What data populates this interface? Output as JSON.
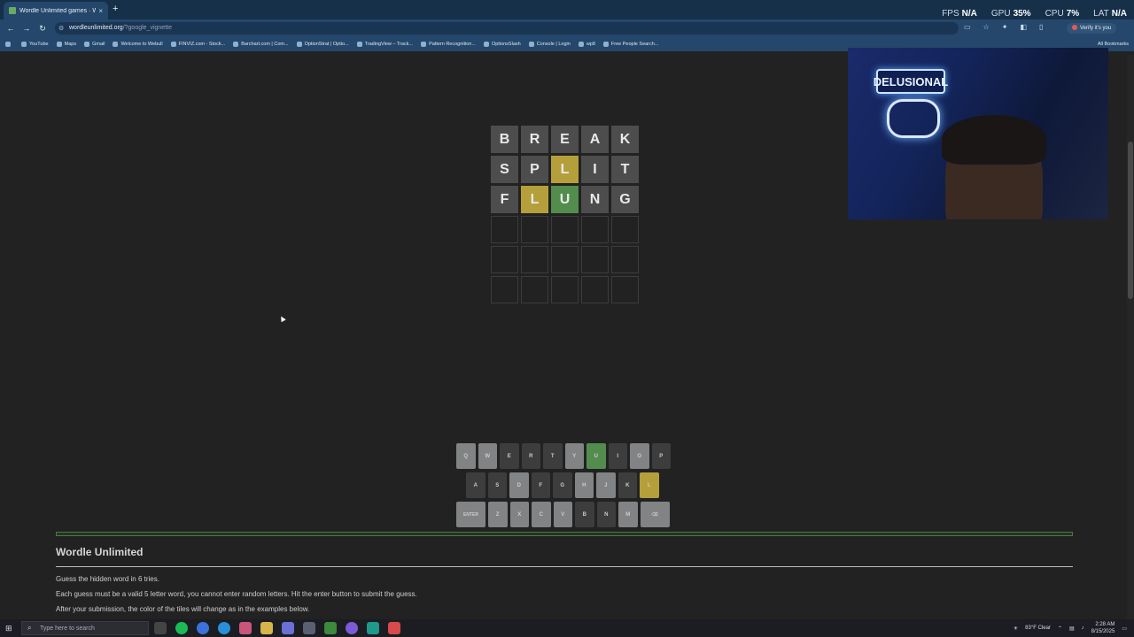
{
  "browser": {
    "tab_title": "Wordle Unlimited games · Wo",
    "tab_close": "×",
    "new_tab": "+",
    "url_host": "wordleunlimited.org",
    "url_path": "/?google_vignette",
    "verify_label": "Verify it's you",
    "bookmarks": [
      "YouTube",
      "Maps",
      "Gmail",
      "Welcome to Webull",
      "FINVIZ.com - Stock...",
      "Barchart.com | Com...",
      "OptionStrat | Optio...",
      "TradingView – Track...",
      "Pattern Recognition...",
      "OptionsSlash",
      "Console | Login",
      "wp8",
      "Free People Search..."
    ],
    "all_bookmarks": "All Bookmarks"
  },
  "overlay": {
    "fps_label": "FPS",
    "fps_value": "N/A",
    "gpu_label": "GPU",
    "gpu_value": "35%",
    "cpu_label": "CPU",
    "cpu_value": "7%",
    "lat_label": "LAT",
    "lat_value": "N/A"
  },
  "webcam": {
    "sign_text": "DELUSIONAL"
  },
  "board": {
    "rows": [
      [
        {
          "l": "B",
          "s": "absent"
        },
        {
          "l": "R",
          "s": "absent"
        },
        {
          "l": "E",
          "s": "absent"
        },
        {
          "l": "A",
          "s": "absent"
        },
        {
          "l": "K",
          "s": "absent"
        }
      ],
      [
        {
          "l": "S",
          "s": "absent"
        },
        {
          "l": "P",
          "s": "absent"
        },
        {
          "l": "L",
          "s": "present"
        },
        {
          "l": "I",
          "s": "absent"
        },
        {
          "l": "T",
          "s": "absent"
        }
      ],
      [
        {
          "l": "F",
          "s": "absent"
        },
        {
          "l": "L",
          "s": "present"
        },
        {
          "l": "U",
          "s": "correct"
        },
        {
          "l": "N",
          "s": "absent"
        },
        {
          "l": "G",
          "s": "absent"
        }
      ]
    ],
    "total_rows": 6
  },
  "keyboard": {
    "rows": [
      [
        {
          "k": "Q",
          "s": "used"
        },
        {
          "k": "W",
          "s": "used"
        },
        {
          "k": "E",
          "s": ""
        },
        {
          "k": "R",
          "s": ""
        },
        {
          "k": "T",
          "s": ""
        },
        {
          "k": "Y",
          "s": "used"
        },
        {
          "k": "U",
          "s": "correct"
        },
        {
          "k": "I",
          "s": ""
        },
        {
          "k": "O",
          "s": "used"
        },
        {
          "k": "P",
          "s": ""
        }
      ],
      [
        {
          "k": "A",
          "s": ""
        },
        {
          "k": "S",
          "s": ""
        },
        {
          "k": "D",
          "s": "used"
        },
        {
          "k": "F",
          "s": ""
        },
        {
          "k": "G",
          "s": ""
        },
        {
          "k": "H",
          "s": "used"
        },
        {
          "k": "J",
          "s": "used"
        },
        {
          "k": "K",
          "s": ""
        },
        {
          "k": "L",
          "s": "present"
        }
      ],
      [
        {
          "k": "ENTER",
          "s": "used",
          "wide": true
        },
        {
          "k": "Z",
          "s": "used"
        },
        {
          "k": "X",
          "s": "used"
        },
        {
          "k": "C",
          "s": "used"
        },
        {
          "k": "V",
          "s": "used"
        },
        {
          "k": "B",
          "s": ""
        },
        {
          "k": "N",
          "s": ""
        },
        {
          "k": "M",
          "s": "used"
        },
        {
          "k": "⌫",
          "s": "used",
          "wide": true
        }
      ]
    ]
  },
  "info": {
    "title": "Wordle Unlimited",
    "line1": "Guess the hidden word in 6 tries.",
    "line2": "Each guess must be a valid 5 letter word, you cannot enter random letters. Hit the enter button to submit the guess.",
    "line3": "After your submission, the color of the tiles will change as in the examples below."
  },
  "taskbar": {
    "search_placeholder": "Type here to search",
    "weather": "83°F  Clear",
    "time": "2:28 AM",
    "date": "8/15/2025"
  },
  "colors": {
    "correct": "#538d4e",
    "present": "#b59f3b",
    "absent": "#4d4d4d"
  }
}
